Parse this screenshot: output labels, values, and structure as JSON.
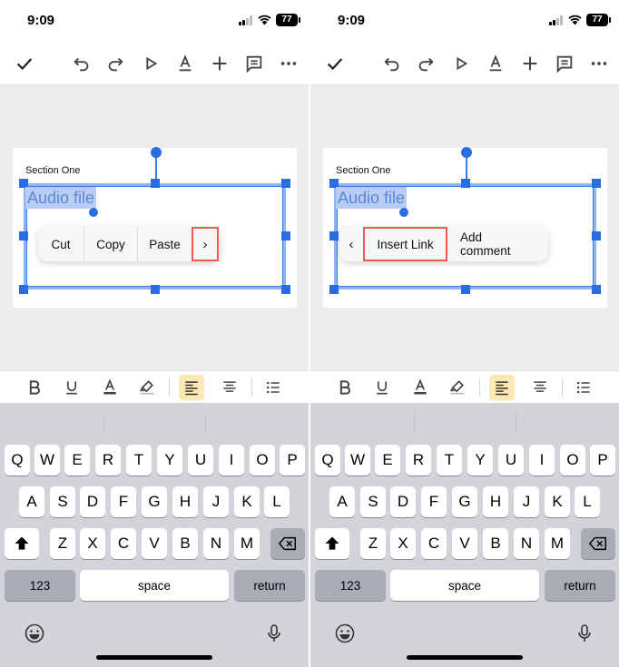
{
  "status": {
    "time": "9:09",
    "battery": "77"
  },
  "document": {
    "section_title": "Section One",
    "selected_text": "Audio file"
  },
  "left_menu": {
    "cut": "Cut",
    "copy": "Copy",
    "paste": "Paste",
    "next_arrow": "›"
  },
  "right_menu": {
    "back_arrow": "‹",
    "insert_link": "Insert Link",
    "add_comment": "Add comment"
  },
  "keyboard": {
    "row1": [
      "Q",
      "W",
      "E",
      "R",
      "T",
      "Y",
      "U",
      "I",
      "O",
      "P"
    ],
    "row2": [
      "A",
      "S",
      "D",
      "F",
      "G",
      "H",
      "J",
      "K",
      "L"
    ],
    "row3": [
      "Z",
      "X",
      "C",
      "V",
      "B",
      "N",
      "M"
    ],
    "numbers_key": "123",
    "space_key": "space",
    "return_key": "return"
  },
  "icons": {
    "toolbar": [
      "check-icon",
      "undo-icon",
      "redo-icon",
      "play-icon",
      "text-color-icon",
      "insert-plus-icon",
      "comment-icon",
      "more-icon"
    ],
    "format": [
      "bold-icon",
      "underline-icon",
      "text-color-icon",
      "highlight-icon",
      "align-left-icon",
      "align-center-icon",
      "list-icon"
    ],
    "keyboard": [
      "shift-icon",
      "backspace-icon",
      "emoji-icon",
      "microphone-icon"
    ]
  },
  "colors": {
    "selection": "#2a6de0",
    "callout": "#f15a4e",
    "active_format": "#fbe8b4"
  }
}
